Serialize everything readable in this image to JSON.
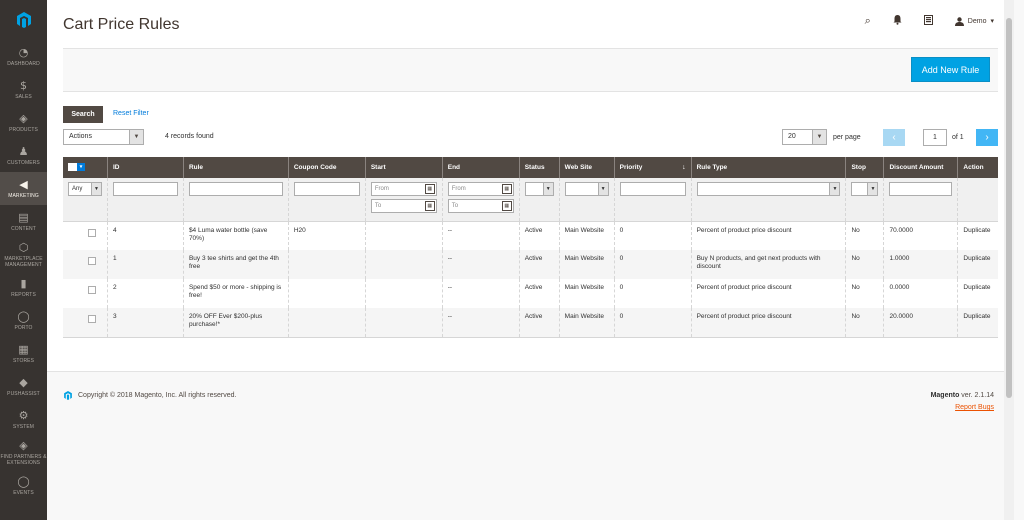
{
  "sidebar": {
    "logo": "magento-logo",
    "items": [
      {
        "icon": "dashboard-icon",
        "glyph": "◔",
        "label": "DASHBOARD"
      },
      {
        "icon": "dollar-icon",
        "glyph": "$",
        "label": "SALES"
      },
      {
        "icon": "box-icon",
        "glyph": "◈",
        "label": "PRODUCTS"
      },
      {
        "icon": "person-icon",
        "glyph": "♟",
        "label": "CUSTOMERS"
      },
      {
        "icon": "megaphone-icon",
        "glyph": "◀",
        "label": "MARKETING",
        "active": true
      },
      {
        "icon": "content-icon",
        "glyph": "▤",
        "label": "CONTENT"
      },
      {
        "icon": "marketplace-icon",
        "glyph": "⬡",
        "label": "MARKETPLACE MANAGEMENT"
      },
      {
        "icon": "reports-icon",
        "glyph": "▮",
        "label": "REPORTS"
      },
      {
        "icon": "porto-icon",
        "glyph": "◯",
        "label": "PORTO"
      },
      {
        "icon": "store-icon",
        "glyph": "▦",
        "label": "STORES"
      },
      {
        "icon": "pushassist-icon",
        "glyph": "◆",
        "label": "PUSHASSIST"
      },
      {
        "icon": "gear-icon",
        "glyph": "⚙",
        "label": "SYSTEM"
      },
      {
        "icon": "partners-icon",
        "glyph": "◈",
        "label": "FIND PARTNERS & EXTENSIONS"
      },
      {
        "icon": "events-icon",
        "glyph": "◯",
        "label": "EVENTS"
      }
    ]
  },
  "header": {
    "title": "Cart Price Rules",
    "search_icon": "⌕",
    "bell_icon": "🔔",
    "grid_icon": "▦",
    "user_icon": "👤",
    "user_name": "Demo",
    "user_caret": "▾"
  },
  "actions": {
    "add_new_rule": "Add New Rule"
  },
  "toolbar": {
    "search_label": "Search",
    "reset_label": "Reset Filter",
    "mass_actions": "Actions",
    "records": "4 records found",
    "per_page_value": "20",
    "per_page_label": "per page",
    "page_current": "1",
    "page_of": "of 1",
    "prev": "‹",
    "next": "›"
  },
  "grid": {
    "columns": [
      "ID",
      "Rule",
      "Coupon Code",
      "Start",
      "End",
      "Status",
      "Web Site",
      "Priority",
      "Rule Type",
      "Stop",
      "Discount Amount",
      "Action"
    ],
    "filters": {
      "any": "Any",
      "from": "From",
      "to": "To"
    },
    "rows": [
      {
        "id": "4",
        "rule": "$4 Luma water bottle (save 70%)",
        "coupon": "H20",
        "start": "",
        "end": "--",
        "status": "Active",
        "website": "Main Website",
        "priority": "0",
        "rule_type": "Percent of product price discount",
        "stop": "No",
        "discount": "70.0000",
        "action": "Duplicate"
      },
      {
        "id": "1",
        "rule": "Buy 3 tee shirts and get the 4th free",
        "coupon": "",
        "start": "",
        "end": "--",
        "status": "Active",
        "website": "Main Website",
        "priority": "0",
        "rule_type": "Buy N products, and get next products with discount",
        "stop": "No",
        "discount": "1.0000",
        "action": "Duplicate"
      },
      {
        "id": "2",
        "rule": "Spend $50 or more - shipping is free!",
        "coupon": "",
        "start": "",
        "end": "--",
        "status": "Active",
        "website": "Main Website",
        "priority": "0",
        "rule_type": "Percent of product price discount",
        "stop": "No",
        "discount": "0.0000",
        "action": "Duplicate"
      },
      {
        "id": "3",
        "rule": "20% OFF Ever $200-plus purchase!*",
        "coupon": "",
        "start": "",
        "end": "--",
        "status": "Active",
        "website": "Main Website",
        "priority": "0",
        "rule_type": "Percent of product price discount",
        "stop": "No",
        "discount": "20.0000",
        "action": "Duplicate"
      }
    ]
  },
  "footer": {
    "copyright": "Copyright © 2018 Magento, Inc. All rights reserved.",
    "brand": "Magento",
    "version": " ver. 2.1.14",
    "report": "Report Bugs"
  },
  "colors": {
    "accent": "#00a2e3",
    "sidebar": "#373330",
    "header_row": "#514943",
    "link": "#007bdb",
    "report": "#eb5202"
  }
}
